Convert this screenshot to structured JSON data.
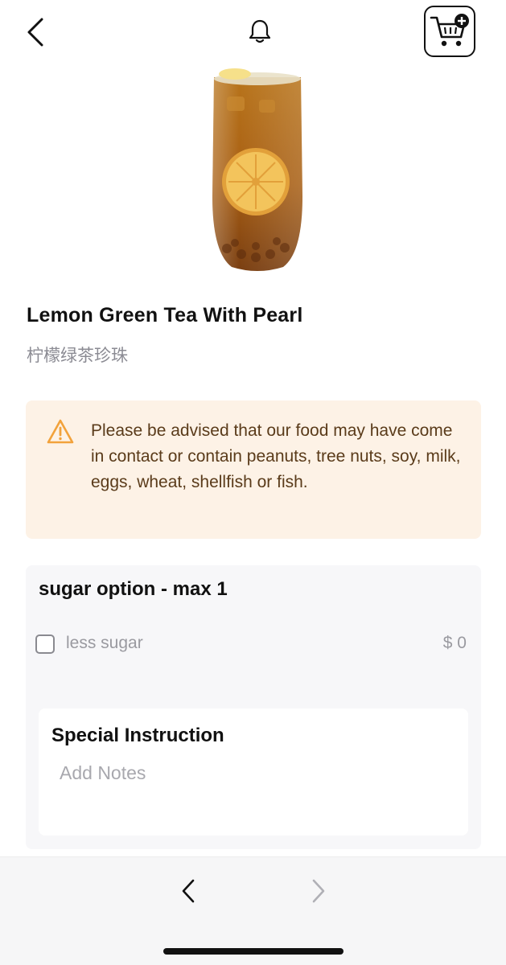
{
  "header": {
    "back_icon": "chevron-left-icon",
    "notification_icon": "bell-icon",
    "cart_icon": "cart-add-icon"
  },
  "product": {
    "image_alt": "lemon-green-tea-drink",
    "title": "Lemon Green Tea With Pearl",
    "subtitle": "柠檬绿茶珍珠"
  },
  "allergen": {
    "icon": "warning-triangle-icon",
    "message": "Please be advised that our food may have come in contact or contain peanuts, tree nuts, soy, milk, eggs, wheat, shellfish or fish.",
    "accent_color": "#f2a23b",
    "background_color": "#fdf2e6"
  },
  "options": {
    "title": "sugar option - max 1",
    "items": [
      {
        "label": "less sugar",
        "price": "$ 0",
        "checked": false
      }
    ]
  },
  "special_instruction": {
    "title": "Special Instruction",
    "placeholder": "Add Notes",
    "value": ""
  },
  "footer": {
    "prev_icon": "chevron-left-icon",
    "next_icon": "chevron-right-icon",
    "next_enabled": false
  }
}
